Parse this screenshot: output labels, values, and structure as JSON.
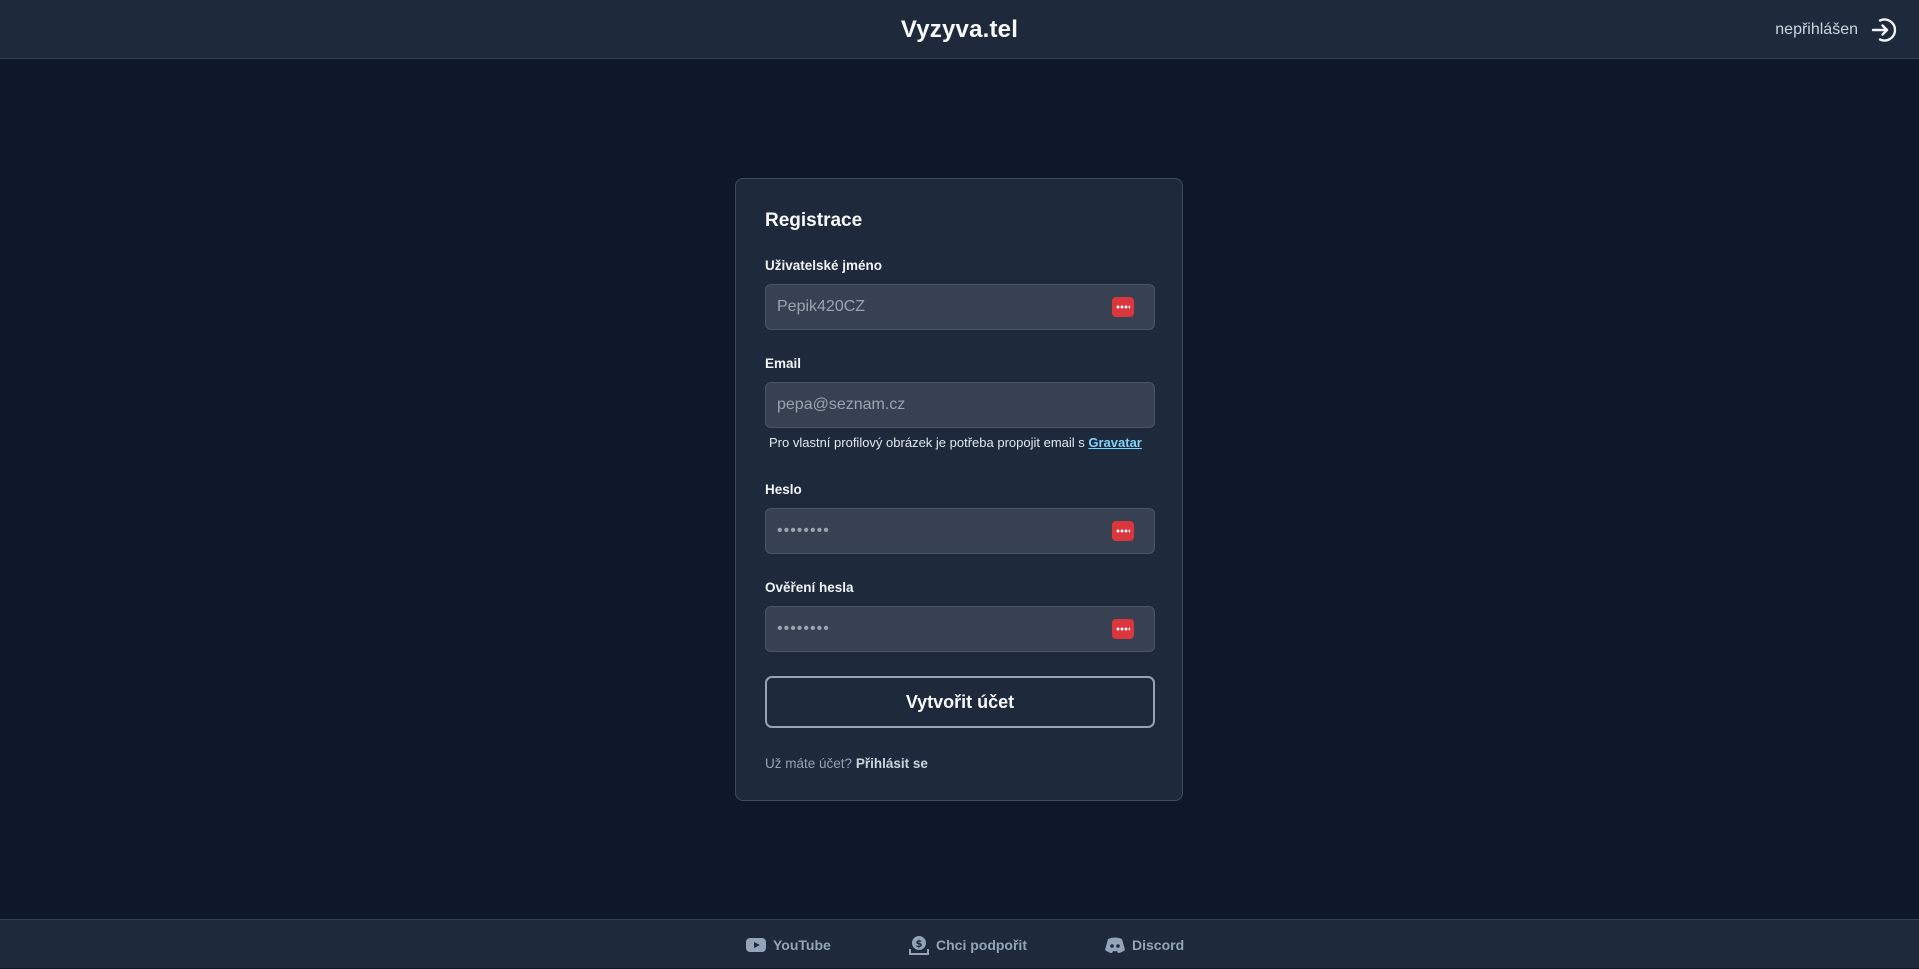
{
  "header": {
    "brand": "Vyzyva.tel",
    "auth_status": "nepřihlášen",
    "auth_icon": "login-icon"
  },
  "form": {
    "title": "Registrace",
    "username": {
      "label": "Uživatelské jméno",
      "placeholder": "Pepik420CZ"
    },
    "email": {
      "label": "Email",
      "placeholder": "pepa@seznam.cz"
    },
    "email_hint": {
      "text": "Pro vlastní profilový obrázek je potřeba propojit email s",
      "link": "Gravatar"
    },
    "password": {
      "label": "Heslo",
      "placeholder": "••••••••"
    },
    "password_confirm": {
      "label": "Ověření hesla",
      "placeholder": "••••••••"
    },
    "submit_label": "Vytvořit účet",
    "login_prompt": "Už máte účet?",
    "login_link": "Přihlásit se",
    "password_manager_icon_color": "#d9363e"
  },
  "footer": {
    "links": [
      {
        "label": "YouTube",
        "icon": "youtube-icon"
      },
      {
        "label": "Chci podpořit",
        "icon": "donate-icon"
      },
      {
        "label": "Discord",
        "icon": "discord-icon"
      }
    ]
  },
  "colors": {
    "background": "#0f172a",
    "surface": "#1e293b",
    "input": "#374151",
    "link": "#7dd3fc"
  }
}
